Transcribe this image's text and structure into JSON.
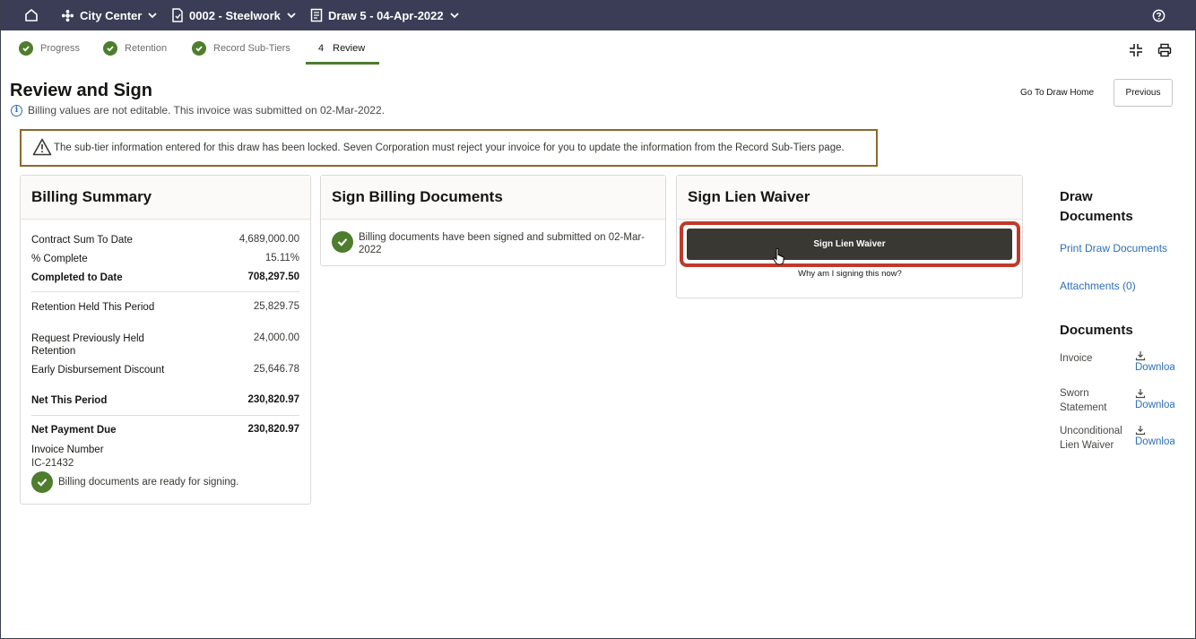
{
  "topbar": {
    "project": "City Center",
    "contract": "0002 - Steelwork",
    "draw": "Draw 5 - 04-Apr-2022"
  },
  "steps": [
    {
      "label": "Progress",
      "state": "done"
    },
    {
      "label": "Retention",
      "state": "done"
    },
    {
      "label": "Record Sub-Tiers",
      "state": "done"
    },
    {
      "number": "4",
      "label": "Review",
      "state": "active"
    }
  ],
  "page": {
    "title": "Review and Sign",
    "info": "Billing values are not editable. This invoice was submitted on 02-Mar-2022.",
    "go_home": "Go To Draw Home",
    "previous": "Previous",
    "warning": "The sub-tier information entered for this draw has been locked. Seven Corporation must reject your invoice for you to update the information from the Record Sub-Tiers page."
  },
  "billing_summary": {
    "title": "Billing Summary",
    "rows": [
      {
        "label": "Contract Sum To Date",
        "value": "4,689,000.00",
        "bold": false
      },
      {
        "label": "% Complete",
        "value": "15.11%",
        "bold": false
      },
      {
        "label": "Completed to Date",
        "value": "708,297.50",
        "bold": true
      },
      {
        "label": "Retention Held This Period",
        "value": "25,829.75",
        "bold": false
      },
      {
        "label": "Request Previously Held Retention",
        "value": "24,000.00",
        "bold": false
      },
      {
        "label": "Early Disbursement Discount",
        "value": "25,646.78",
        "bold": false
      },
      {
        "label": "Net This Period",
        "value": "230,820.97",
        "bold": true
      },
      {
        "label": "Net Payment Due",
        "value": "230,820.97",
        "bold": true
      }
    ],
    "invoice_label": "Invoice Number",
    "invoice_number": "IC-21432",
    "ready_msg": "Billing documents are ready for signing."
  },
  "sign_billing": {
    "title": "Sign Billing Documents",
    "message": "Billing documents have been signed and submitted on 02-Mar-2022"
  },
  "sign_lien": {
    "title": "Sign Lien Waiver",
    "button": "Sign Lien Waiver",
    "why": "Why am I signing this now?"
  },
  "right": {
    "draw_docs_title": "Draw Documents",
    "print": "Print Draw Documents",
    "attachments": "Attachments (0)",
    "documents_title": "Documents",
    "docs": [
      {
        "name": "Invoice",
        "action": "Download"
      },
      {
        "name": "Sworn Statement",
        "action": "Download"
      },
      {
        "name": "Unconditional Lien Waiver",
        "action": "Download"
      }
    ]
  },
  "colors": {
    "topbar": "#3a3d55",
    "success": "#4e7d2e",
    "link": "#2d6fb5",
    "highlight": "#c0392b",
    "warning_border": "#8a6a2a"
  }
}
